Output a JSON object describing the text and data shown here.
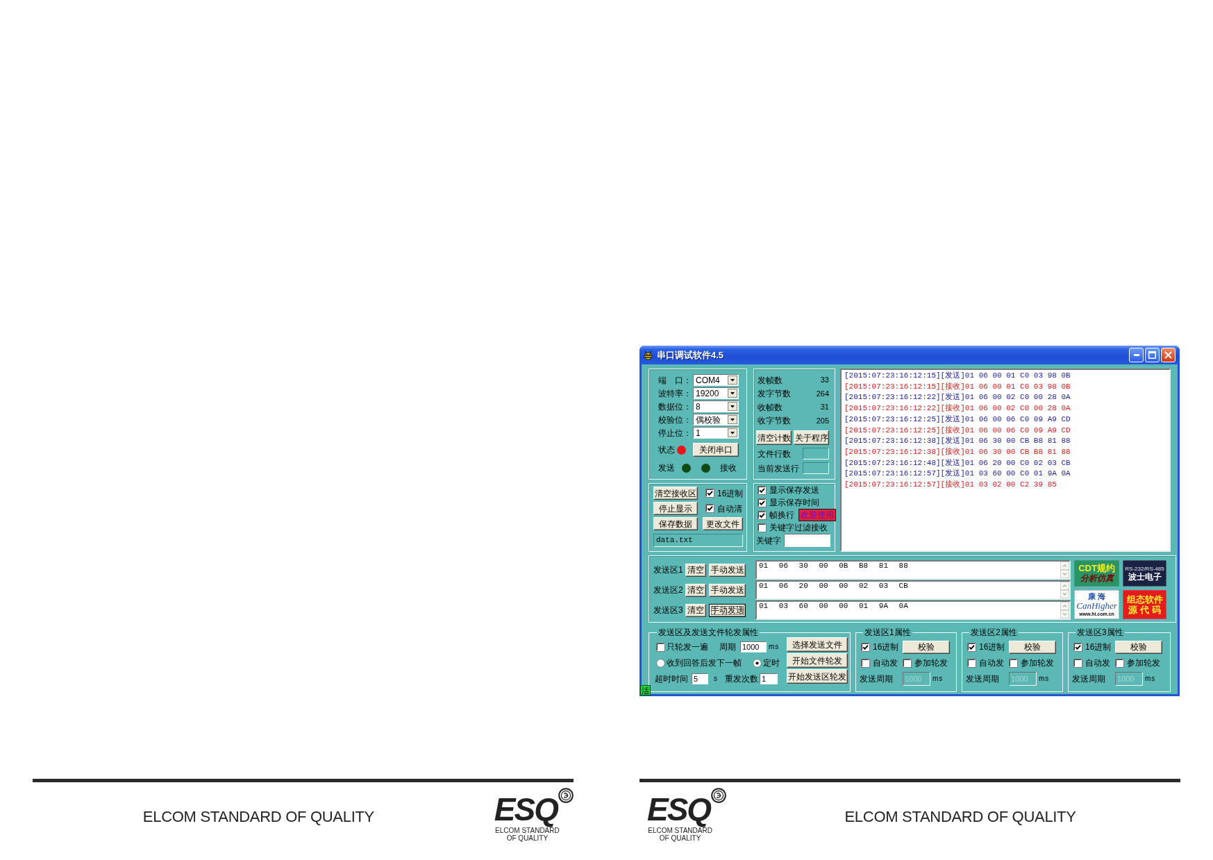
{
  "pages": [
    {
      "footer": {
        "text": "ELCOM STANDARD OF QUALITY",
        "logo": {
          "mark": "ESQ",
          "caption": [
            "ELCOM STANDARD",
            "OF QUALITY"
          ]
        }
      }
    },
    {
      "window": {
        "title": "串口调试软件4.5",
        "port_settings": [
          {
            "label": "端　口：",
            "value": "COM4"
          },
          {
            "label": "波特率：",
            "value": "19200"
          },
          {
            "label": "数据位：",
            "value": "8"
          },
          {
            "label": "校验位：",
            "value": "偶校验"
          },
          {
            "label": "停止位：",
            "value": "1"
          }
        ],
        "status_indicator": {
          "label": "状态",
          "color": "#e8141c"
        },
        "close_port_button": "关闭串口",
        "traffic_indicators": [
          {
            "label": "发送",
            "color": "#0e4a12"
          },
          {
            "label": "接收",
            "color": "#0e4a12"
          }
        ],
        "counters": [
          {
            "label": "发帧数",
            "value": "33"
          },
          {
            "label": "发字节数",
            "value": "264"
          },
          {
            "label": "收帧数",
            "value": "31"
          },
          {
            "label": "收字节数",
            "value": "205"
          }
        ],
        "counter_buttons": [
          "清空计数",
          "关于程序"
        ],
        "file_fields": [
          {
            "label": "文件行数"
          },
          {
            "label": "当前发送行"
          }
        ],
        "receive_controls": [
          {
            "kind": "button",
            "label": "清空接收区"
          },
          {
            "kind": "checkbox",
            "label": "16进制",
            "checked": true
          },
          {
            "kind": "button",
            "label": "停止显示"
          },
          {
            "kind": "checkbox",
            "label": "自动清",
            "checked": true
          },
          {
            "kind": "button",
            "label": "保存数据"
          },
          {
            "kind": "button",
            "label": "更改文件"
          }
        ],
        "file_name": "data.txt",
        "display_options": [
          {
            "label": "显示保存发送",
            "checked": true
          },
          {
            "label": "显示保存时间",
            "checked": true
          },
          {
            "label": "帧换行",
            "checked": true,
            "badge": "欢迎使用"
          },
          {
            "label": "关键字过滤接收",
            "checked": false
          }
        ],
        "keyword_field": {
          "label": "关键字"
        },
        "log": [
          {
            "kind": "send",
            "text": "[2015:07:23:16:12:15][发送]01 06 00 01 C0 03 98 0B"
          },
          {
            "kind": "receive",
            "text": "[2015:07:23:16:12:15][接收]01 06 00 01 C0 03 98 0B"
          },
          {
            "kind": "send",
            "text": "[2015:07:23:16:12:22][发送]01 06 00 02 C0 00 28 0A"
          },
          {
            "kind": "receive",
            "text": "[2015:07:23:16:12:22][接收]01 06 00 02 C0 00 28 0A"
          },
          {
            "kind": "send",
            "text": "[2015:07:23:16:12:25][发送]01 06 00 06 C0 09 A9 CD"
          },
          {
            "kind": "receive",
            "text": "[2015:07:23:16:12:25][接收]01 06 00 06 C0 09 A9 CD"
          },
          {
            "kind": "send",
            "text": "[2015:07:23:16:12:38][发送]01 06 30 00 CB B8 81 88"
          },
          {
            "kind": "receive",
            "text": "[2015:07:23:16:12:38][接收]01 06 30 00 CB B8 81 88"
          },
          {
            "kind": "send",
            "text": "[2015:07:23:16:12:48][发送]01 06 20 00 C0 02 03 CB"
          },
          {
            "kind": "send",
            "text": "[2015:07:23:16:12:57][发送]01 03 60 00 C0 01 9A 0A"
          },
          {
            "kind": "receive",
            "text": "[2015:07:23:16:12:57][接收]01 03 02 00 C2 39 85"
          }
        ],
        "send_areas": [
          {
            "label": "发送区1",
            "clear_button": "清空",
            "send_button": "手动发送",
            "focused": false,
            "value": "01 06 30 00 0B B8 81 88"
          },
          {
            "label": "发送区2",
            "clear_button": "清空",
            "send_button": "手动发送",
            "focused": false,
            "value": "01 06 20 00 00 02 03 CB"
          },
          {
            "label": "发送区3",
            "clear_button": "清空",
            "send_button": "手动发送",
            "focused": true,
            "value": "01 03 60 00 00 01 9A 0A"
          }
        ],
        "ad_tiles": [
          {
            "kind": "cdt",
            "lines": [
              "CDT规约",
              "分析仿真"
            ]
          },
          {
            "kind": "boshi",
            "lines": [
              "RS-232/RS-485",
              "波士电子"
            ]
          },
          {
            "kind": "canhigher",
            "lines": [
              "康 海",
              "CanHigher",
              "www.hi.com.cn"
            ]
          },
          {
            "kind": "source",
            "lines": [
              "组态软件",
              "源 代 码"
            ]
          }
        ],
        "cycle_settings": {
          "title": "发送区及发送文件轮发属性",
          "once": {
            "label": "只轮发一遍",
            "checked": false
          },
          "period": {
            "label": "周期",
            "value": "1000",
            "unit": "ms"
          },
          "modes": [
            {
              "label": "收到回答后发下一帧",
              "selected": false
            },
            {
              "label": "定时",
              "selected": true
            }
          ],
          "timeout": {
            "label": "超时时间",
            "value": "5",
            "unit": "s"
          },
          "retries": {
            "label": "重发次数",
            "value": "1"
          },
          "buttons": [
            "选择发送文件",
            "开始文件轮发",
            "开始发送区轮发"
          ]
        },
        "area_properties": [
          {
            "title": "发送区1属性",
            "hex": {
              "label": "16进制",
              "checked": true
            },
            "check_button": "校验",
            "auto_send": {
              "label": "自动发",
              "checked": false
            },
            "join_cycle": {
              "label": "参加轮发",
              "checked": false
            },
            "period": {
              "label": "发送周期",
              "value": "1000",
              "unit": "ms",
              "disabled": true
            }
          },
          {
            "title": "发送区2属性",
            "hex": {
              "label": "16进制",
              "checked": true
            },
            "check_button": "校验",
            "auto_send": {
              "label": "自动发",
              "checked": false
            },
            "join_cycle": {
              "label": "参加轮发",
              "checked": false
            },
            "period": {
              "label": "发送周期",
              "value": "1000",
              "unit": "ms",
              "disabled": true
            }
          },
          {
            "title": "发送区3属性",
            "hex": {
              "label": "16进制",
              "checked": true
            },
            "check_button": "校验",
            "auto_send": {
              "label": "自动发",
              "checked": false
            },
            "join_cycle": {
              "label": "参加轮发",
              "checked": false
            },
            "period": {
              "label": "发送周期",
              "value": "1000",
              "unit": "ms",
              "disabled": true
            }
          }
        ],
        "status_badge": "活"
      },
      "footer": {
        "text": "ELCOM STANDARD OF QUALITY",
        "logo": {
          "mark": "ESQ",
          "caption": [
            "ELCOM STANDARD",
            "OF QUALITY"
          ]
        }
      }
    }
  ]
}
